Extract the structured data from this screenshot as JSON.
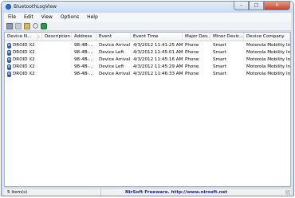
{
  "window": {
    "title": "BluetoothLogView",
    "minimize_glyph": "–",
    "maximize_glyph": "□",
    "close_glyph": "✕"
  },
  "menu": [
    "File",
    "Edit",
    "View",
    "Options",
    "Help"
  ],
  "toolbar": {
    "icons": [
      "save-icon",
      "copy-icon",
      "properties-icon",
      "find-icon",
      "refresh-icon"
    ]
  },
  "table": {
    "columns": [
      "Device N...",
      "Description",
      "Address",
      "Event",
      "Event Time",
      "Major Dev...",
      "Minor Devic...",
      "Device Company"
    ],
    "sort_glyph": "△",
    "rows": [
      {
        "device": "DROID X2",
        "description": "",
        "address": "98-4B-...",
        "event": "Device Arrival",
        "time": "4/3/2012 11:41:25 AM",
        "major": "Phone",
        "minor": "Smart",
        "company": "Motorola Mobility Inc."
      },
      {
        "device": "DROID X2",
        "description": "",
        "address": "98-4B-...",
        "event": "Device Left",
        "time": "4/3/2012 11:45:01 AM",
        "major": "Phone",
        "minor": "Smart",
        "company": "Motorola Mobility Inc."
      },
      {
        "device": "DROID X2",
        "description": "",
        "address": "98-4B-...",
        "event": "Device Arrival",
        "time": "4/3/2012 11:45:16 AM",
        "major": "Phone",
        "minor": "Smart",
        "company": "Motorola Mobility Inc."
      },
      {
        "device": "DROID X2",
        "description": "",
        "address": "98-4B-...",
        "event": "Device Left",
        "time": "4/3/2012 11:45:29 AM",
        "major": "Phone",
        "minor": "Smart",
        "company": "Motorola Mobility Inc."
      },
      {
        "device": "DROID X2",
        "description": "",
        "address": "98-4B-...",
        "event": "Device Arrival",
        "time": "4/3/2012 11:46:33 AM",
        "major": "Phone",
        "minor": "Smart",
        "company": "Motorola Mobility Inc."
      }
    ],
    "row_icon": "bluetooth-icon",
    "row_icon_glyph": "ʙ"
  },
  "status": {
    "count": "5 item(s)",
    "credit": "NirSoft Freeware.  http://www.nirsoft.net"
  }
}
